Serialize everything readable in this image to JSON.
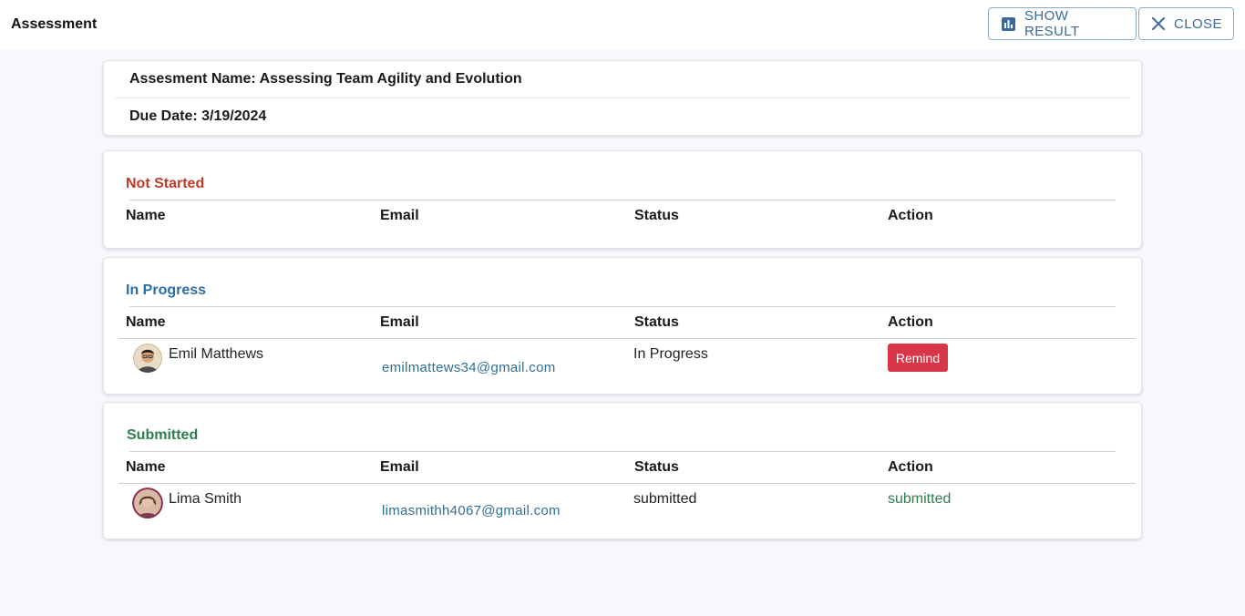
{
  "header": {
    "title": "Assessment",
    "show_result_label": "SHOW RESULT",
    "close_label": "CLOSE"
  },
  "assessment": {
    "name_line": "Assesment Name: Assessing Team Agility and Evolution",
    "due_line": "Due Date: 3/19/2024"
  },
  "columns": {
    "name": "Name",
    "email": "Email",
    "status": "Status",
    "action": "Action"
  },
  "sections": {
    "not_started": {
      "title": "Not Started",
      "color": "#c0392b"
    },
    "in_progress": {
      "title": "In Progress",
      "color": "#2e6da4",
      "rows": [
        {
          "name": "Emil Matthews",
          "email": "emilmattews34@gmail.com",
          "status": "In Progress",
          "action": "Remind"
        }
      ]
    },
    "submitted": {
      "title": "Submitted",
      "color": "#2e7d4f",
      "rows": [
        {
          "name": "Lima Smith",
          "email": "limasmithh4067@gmail.com",
          "status": "submitted",
          "action": "submitted"
        }
      ]
    }
  },
  "icons": {
    "show_result": "bar-chart-icon",
    "close": "close-icon"
  }
}
